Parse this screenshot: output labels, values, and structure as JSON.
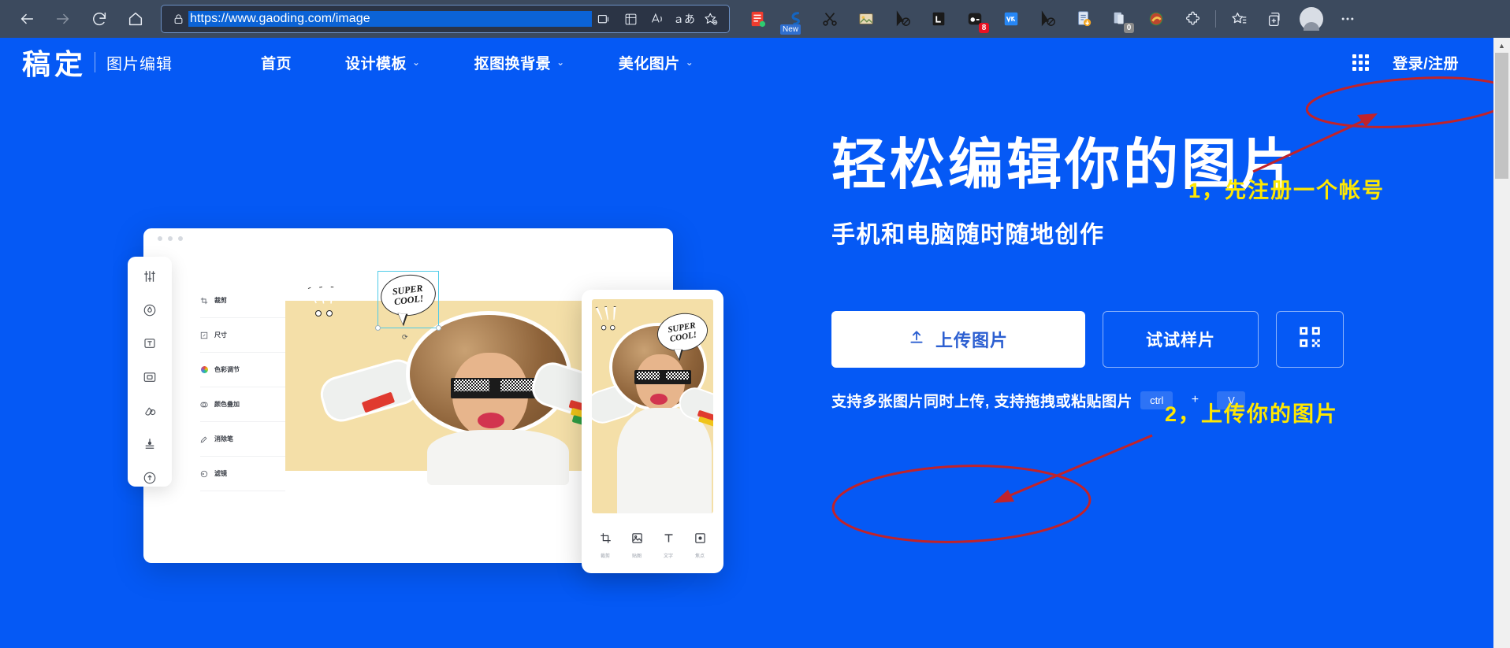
{
  "browser": {
    "url": "https://www.gaoding.com/image",
    "back_icon": "back-arrow-icon",
    "forward_icon": "forward-arrow-icon",
    "reload_icon": "reload-icon",
    "home_icon": "home-icon",
    "lock_icon": "lock-icon",
    "toolbar_icons": [
      "split-screen-icon",
      "collections-icon",
      "read-aloud-icon",
      "translate-icon",
      "add-favorite-icon"
    ],
    "extensions": [
      {
        "name": "notes-extension",
        "badge": ""
      },
      {
        "name": "snipaste-extension",
        "badge": "New"
      },
      {
        "name": "scissors-extension",
        "badge": ""
      },
      {
        "name": "image-tool-extension",
        "badge": ""
      },
      {
        "name": "cursor-block-extension",
        "badge": ""
      },
      {
        "name": "lastpass-extension",
        "badge": ""
      },
      {
        "name": "recorder-extension",
        "badge": "8"
      },
      {
        "name": "vk-extension",
        "badge": ""
      },
      {
        "name": "adblock-cursor-extension",
        "badge": ""
      },
      {
        "name": "downloader-extension",
        "badge": ""
      },
      {
        "name": "pdf-extension",
        "badge": "0"
      },
      {
        "name": "winrar-extension",
        "badge": ""
      },
      {
        "name": "puzzle-extensions-icon",
        "badge": ""
      }
    ],
    "favorites_icon": "favorites-icon",
    "collections_icon": "collections-pane-icon",
    "profile_icon": "profile-avatar-icon",
    "more_icon": "more-options-icon"
  },
  "site": {
    "logo": "稿定",
    "logo_sub": "图片编辑",
    "nav_links": [
      {
        "label": "首页",
        "has_caret": false
      },
      {
        "label": "设计模板",
        "has_caret": true
      },
      {
        "label": "抠图换背景",
        "has_caret": true
      },
      {
        "label": "美化图片",
        "has_caret": true
      }
    ],
    "apps_icon": "apps-grid-icon",
    "login_label": "登录/注册"
  },
  "hero": {
    "headline": "轻松编辑你的图片",
    "subhead": "手机和电脑随时随地创作",
    "upload_label": "上传图片",
    "upload_icon": "upload-icon",
    "sample_label": "试试样片",
    "qr_icon": "qrcode-icon",
    "hint_text": "支持多张图片同时上传, 支持拖拽或粘贴图片",
    "keys": [
      "ctrl",
      "+",
      "V"
    ]
  },
  "mockup": {
    "rail_icons": [
      "adjust-sliders-icon",
      "magic-wand-icon",
      "text-box-icon",
      "frame-icon",
      "sticker-icon",
      "stamp-icon",
      "cloud-upload-icon"
    ],
    "panel_items": [
      {
        "label": "裁剪",
        "icon": "crop-icon"
      },
      {
        "label": "尺寸",
        "icon": "resize-icon"
      },
      {
        "label": "色彩调节",
        "icon": "color-wheel-icon"
      },
      {
        "label": "颜色叠加",
        "icon": "color-overlay-icon"
      },
      {
        "label": "消除笔",
        "icon": "eraser-pen-icon"
      },
      {
        "label": "滤镜",
        "icon": "filter-icon"
      }
    ],
    "bubble_line1": "SUPER",
    "bubble_line2": "COOL!",
    "phone_tools": [
      {
        "label": "裁剪",
        "icon": "crop-icon"
      },
      {
        "label": "贴图",
        "icon": "sticker-image-icon"
      },
      {
        "label": "文字",
        "icon": "text-icon"
      },
      {
        "label": "焦点",
        "icon": "focus-icon"
      }
    ]
  },
  "annotations": [
    {
      "id": "step-1",
      "text": "1，先注册一个帐号"
    },
    {
      "id": "step-2",
      "text": "2，上传你的图片"
    }
  ],
  "colors": {
    "page_blue": "#0559f5",
    "chrome": "#3c4a5e",
    "annotation_text": "#ffe800",
    "annotation_stroke": "#c0232b",
    "url_highlight": "#0b63d6"
  }
}
